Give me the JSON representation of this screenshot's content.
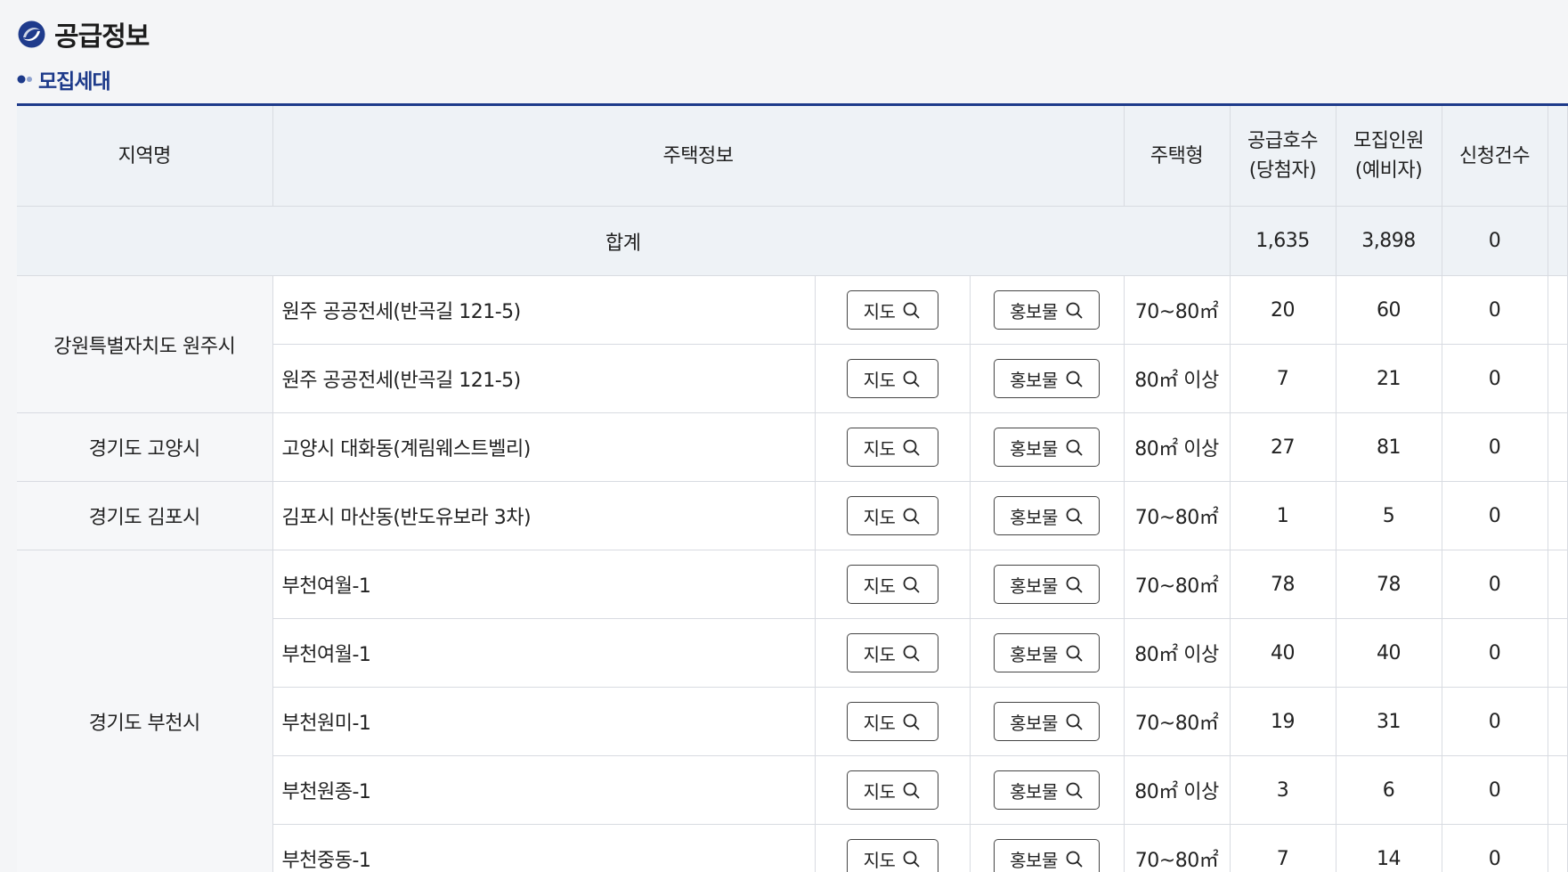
{
  "page": {
    "title": "공급정보",
    "section_title": "모집세대"
  },
  "table": {
    "headers": {
      "region": "지역명",
      "house_info": "주택정보",
      "house_type": "주택형",
      "supply_line1": "공급호수",
      "supply_line2": "(당첨자)",
      "recruit_line1": "모집인원",
      "recruit_line2": "(예비자)",
      "applications": "신청건수"
    },
    "summary": {
      "label": "합계",
      "supply": "1,635",
      "recruit": "3,898",
      "applications": "0"
    },
    "rows": [
      {
        "region": "강원특별자치도 원주시",
        "name": "원주 공공전세(반곡길 121-5)",
        "map": "지도",
        "promo": "홍보물",
        "type": "70~80㎡",
        "supply": "20",
        "recruit": "60",
        "applications": "0"
      },
      {
        "region": "강원특별자치도 원주시",
        "name": "원주 공공전세(반곡길 121-5)",
        "map": "지도",
        "promo": "홍보물",
        "type": "80㎡ 이상",
        "supply": "7",
        "recruit": "21",
        "applications": "0"
      },
      {
        "region": "경기도 고양시",
        "name": "고양시 대화동(계림웨스트벨리)",
        "map": "지도",
        "promo": "홍보물",
        "type": "80㎡ 이상",
        "supply": "27",
        "recruit": "81",
        "applications": "0"
      },
      {
        "region": "경기도 김포시",
        "name": "김포시 마산동(반도유보라 3차)",
        "map": "지도",
        "promo": "홍보물",
        "type": "70~80㎡",
        "supply": "1",
        "recruit": "5",
        "applications": "0"
      },
      {
        "region": "경기도 부천시",
        "name": "부천여월-1",
        "map": "지도",
        "promo": "홍보물",
        "type": "70~80㎡",
        "supply": "78",
        "recruit": "78",
        "applications": "0"
      },
      {
        "region": "경기도 부천시",
        "name": "부천여월-1",
        "map": "지도",
        "promo": "홍보물",
        "type": "80㎡ 이상",
        "supply": "40",
        "recruit": "40",
        "applications": "0"
      },
      {
        "region": "경기도 부천시",
        "name": "부천원미-1",
        "map": "지도",
        "promo": "홍보물",
        "type": "70~80㎡",
        "supply": "19",
        "recruit": "31",
        "applications": "0"
      },
      {
        "region": "경기도 부천시",
        "name": "부천원종-1",
        "map": "지도",
        "promo": "홍보물",
        "type": "80㎡ 이상",
        "supply": "3",
        "recruit": "6",
        "applications": "0"
      },
      {
        "region": "경기도 부천시",
        "name": "부천중동-1",
        "map": "지도",
        "promo": "홍보물",
        "type": "70~80㎡",
        "supply": "7",
        "recruit": "14",
        "applications": "0"
      }
    ]
  },
  "colors": {
    "accent": "#1d3a8a",
    "header_bg": "#eef2f6",
    "border": "#d8dbe1"
  },
  "icons": {
    "title": "logo-swirl-icon",
    "section": "bullet-dots-icon",
    "button": "search-icon"
  }
}
